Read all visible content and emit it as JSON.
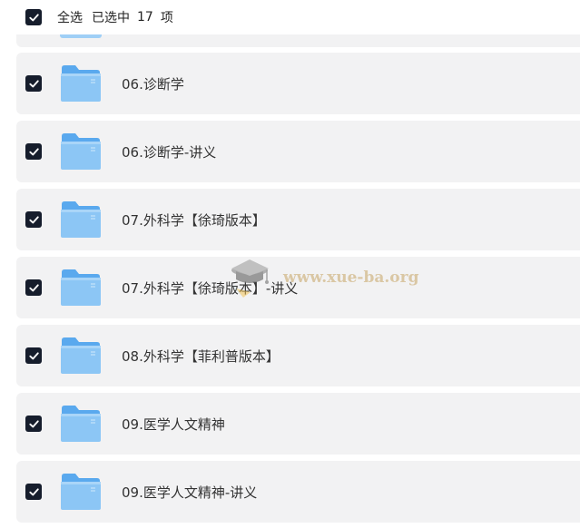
{
  "toolbar": {
    "select_all_label": "全选",
    "selected_prefix": "已选中",
    "selected_count": "17",
    "selected_suffix": "项",
    "select_all_checked": true
  },
  "files": [
    {
      "name": "06.诊断学",
      "checked": true,
      "icon": "folder-icon"
    },
    {
      "name": "06.诊断学-讲义",
      "checked": true,
      "icon": "folder-icon"
    },
    {
      "name": "07.外科学【徐琦版本】",
      "checked": true,
      "icon": "folder-icon"
    },
    {
      "name": "07.外科学【徐琦版本】-讲义",
      "checked": true,
      "icon": "folder-icon"
    },
    {
      "name": "08.外科学【菲利普版本】",
      "checked": true,
      "icon": "folder-icon"
    },
    {
      "name": "09.医学人文精神",
      "checked": true,
      "icon": "folder-icon"
    },
    {
      "name": "09.医学人文精神-讲义",
      "checked": true,
      "icon": "folder-icon"
    }
  ],
  "watermark": {
    "text": "www.xue-ba.org",
    "icon": "graduation-cap-icon"
  },
  "colors": {
    "checkbox": "#161d2c",
    "row_bg": "#f2f2f3",
    "folder_front": "#8cc6f5",
    "folder_back": "#5aa9ee",
    "watermark": "#d2b98a"
  }
}
